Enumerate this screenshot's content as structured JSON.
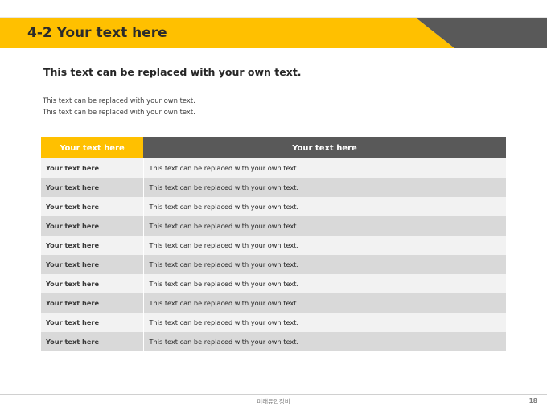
{
  "header": {
    "title": "4-2 Your text here",
    "accent_color": "#ffc000",
    "dark_color": "#595959"
  },
  "subtitle": "This text can be replaced with your own text.",
  "body_lines": [
    "This text can be replaced with your own text.",
    "This text can be replaced with your own text."
  ],
  "table": {
    "headers": [
      "Your text here",
      "Your text here"
    ],
    "rows": [
      [
        "Your text here",
        "This text can be replaced with your own text."
      ],
      [
        "Your text here",
        "This text can be replaced with your own text."
      ],
      [
        "Your text here",
        "This text can be replaced with your own text."
      ],
      [
        "Your text here",
        "This text can be replaced with your own text."
      ],
      [
        "Your text here",
        "This text can be replaced with your own text."
      ],
      [
        "Your text here",
        "This text can be replaced with your own text."
      ],
      [
        "Your text here",
        "This text can be replaced with your own text."
      ],
      [
        "Your text here",
        "This text can be replaced with your own text."
      ],
      [
        "Your text here",
        "This text can be replaced with your own text."
      ],
      [
        "Your text here",
        "This text can be replaced with your own text."
      ]
    ]
  },
  "footer": {
    "text": "미래유압정비",
    "page_number": "18"
  }
}
